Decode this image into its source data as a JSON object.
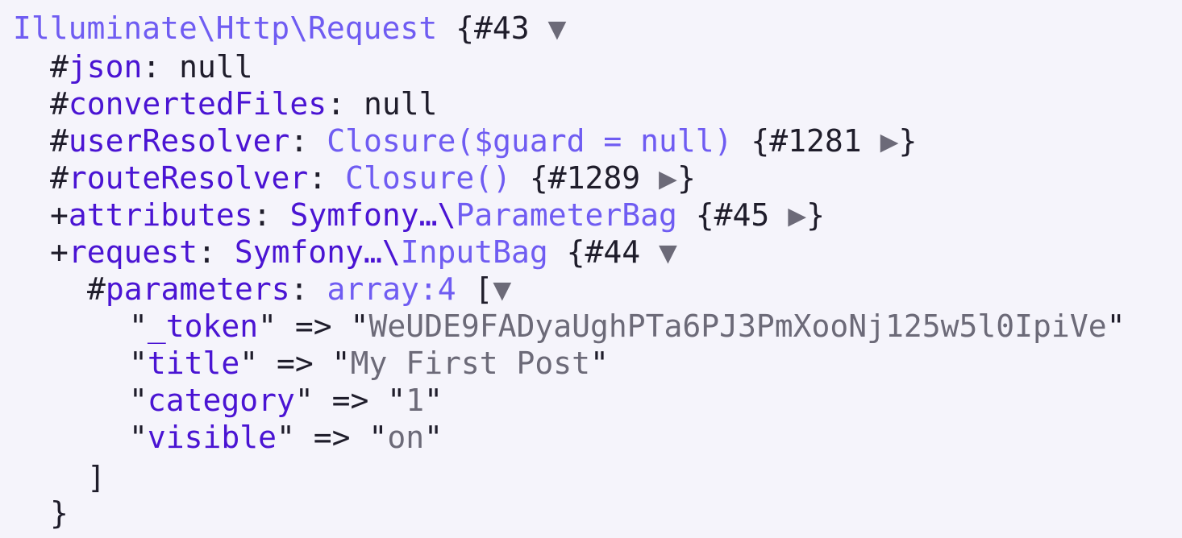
{
  "dump": {
    "root": {
      "class_name": "Illuminate\\Http\\Request",
      "id": "{#43",
      "toggle": "▼"
    },
    "props": [
      {
        "mod": "#",
        "name": "json",
        "sep": ": ",
        "value": "null"
      },
      {
        "mod": "#",
        "name": "convertedFiles",
        "sep": ": ",
        "value": "null"
      },
      {
        "mod": "#",
        "name": "userResolver",
        "sep": ": ",
        "value": "Closure($guard = null)",
        "id": "{#1281",
        "toggle": "▶",
        "close": "}"
      },
      {
        "mod": "#",
        "name": "routeResolver",
        "sep": ": ",
        "value": "Closure()",
        "id": "{#1289",
        "toggle": "▶",
        "close": "}"
      },
      {
        "mod": "+",
        "name": "attributes",
        "sep": ": ",
        "ns": "Symfony…\\",
        "value": "ParameterBag",
        "id": "{#45",
        "toggle": "▶",
        "close": "}"
      },
      {
        "mod": "+",
        "name": "request",
        "sep": ": ",
        "ns": "Symfony…\\",
        "value": "InputBag",
        "id": "{#44",
        "toggle": "▼"
      }
    ],
    "parameters": {
      "mod": "#",
      "name": "parameters",
      "sep": ": ",
      "type": "array:4",
      "open": "[",
      "toggle": "▼",
      "close": "]"
    },
    "entries": [
      {
        "key": "_token",
        "value": "WeUDE9FADyaUghPTa6PJ3PmXooNj125w5l0IpiVe"
      },
      {
        "key": "title",
        "value": "My First Post"
      },
      {
        "key": "category",
        "value": "1"
      },
      {
        "key": "visible",
        "value": "on"
      }
    ],
    "request_close": "}"
  },
  "colors": {
    "background": "#f5f4fb",
    "class_name": "#6f5cf2",
    "property": "#4a14d3",
    "string": "#6c6a78",
    "text": "#1f1d2b"
  }
}
